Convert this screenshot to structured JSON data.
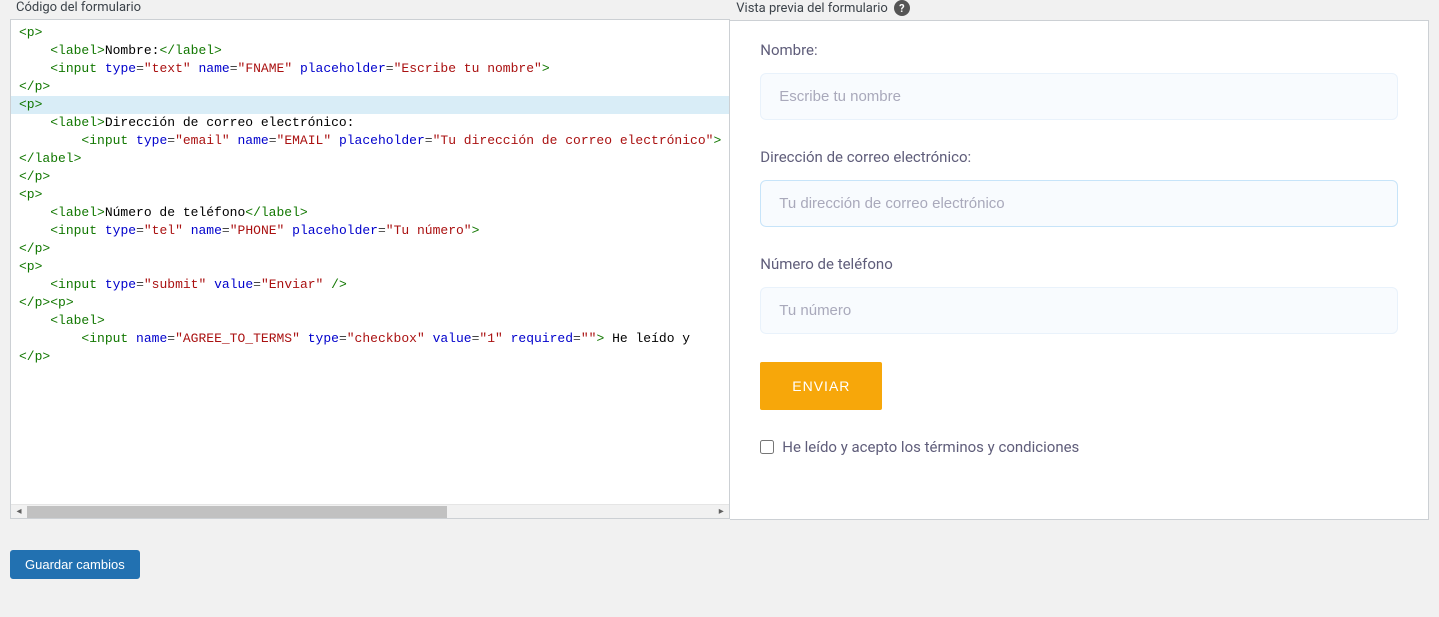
{
  "headers": {
    "code_panel": "Código del formulario",
    "preview_panel": "Vista previa del formulario"
  },
  "code": {
    "lines": [
      {
        "t": "open",
        "tag": "p",
        "indent": 0,
        "hl": false
      },
      {
        "t": "label",
        "tag": "label",
        "text": "Nombre:",
        "indent": 1,
        "hl": false
      },
      {
        "t": "input",
        "tag": "input",
        "attrs": [
          [
            "type",
            "text"
          ],
          [
            "name",
            "FNAME"
          ],
          [
            "placeholder",
            "Escribe tu nombre"
          ]
        ],
        "indent": 1,
        "hl": false
      },
      {
        "t": "close",
        "tag": "p",
        "indent": 0,
        "hl": false
      },
      {
        "t": "open",
        "tag": "p",
        "indent": 0,
        "hl": true
      },
      {
        "t": "labelopen",
        "tag": "label",
        "text": "Dirección de correo electrónico:",
        "indent": 1,
        "hl": false
      },
      {
        "t": "input",
        "tag": "input",
        "attrs": [
          [
            "type",
            "email"
          ],
          [
            "name",
            "EMAIL"
          ],
          [
            "placeholder",
            "Tu dirección de correo electrónico"
          ]
        ],
        "indent": 2,
        "hl": false
      },
      {
        "t": "close",
        "tag": "label",
        "indent": 0,
        "hl": false
      },
      {
        "t": "close",
        "tag": "p",
        "indent": 0,
        "hl": false
      },
      {
        "t": "open",
        "tag": "p",
        "indent": 0,
        "hl": false
      },
      {
        "t": "label",
        "tag": "label",
        "text": "Número de teléfono",
        "indent": 1,
        "hl": false
      },
      {
        "t": "input",
        "tag": "input",
        "attrs": [
          [
            "type",
            "tel"
          ],
          [
            "name",
            "PHONE"
          ],
          [
            "placeholder",
            "Tu número"
          ]
        ],
        "indent": 1,
        "hl": false
      },
      {
        "t": "close",
        "tag": "p",
        "indent": 0,
        "hl": false
      },
      {
        "t": "open",
        "tag": "p",
        "indent": 0,
        "hl": false
      },
      {
        "t": "input_self",
        "tag": "input",
        "attrs": [
          [
            "type",
            "submit"
          ],
          [
            "value",
            "Enviar"
          ]
        ],
        "indent": 1,
        "hl": false
      },
      {
        "t": "close_open",
        "closetag": "p",
        "opentag": "p",
        "indent": 0,
        "hl": false
      },
      {
        "t": "open",
        "tag": "label",
        "indent": 1,
        "hl": false
      },
      {
        "t": "input_text",
        "tag": "input",
        "attrs": [
          [
            "name",
            "AGREE_TO_TERMS"
          ],
          [
            "type",
            "checkbox"
          ],
          [
            "value",
            "1"
          ],
          [
            "required",
            ""
          ]
        ],
        "trailing": " He leído y ",
        "indent": 2,
        "hl": false
      },
      {
        "t": "close",
        "tag": "p",
        "indent": 0,
        "hl": false
      }
    ]
  },
  "preview": {
    "fields": [
      {
        "label": "Nombre:",
        "placeholder": "Escribe tu nombre",
        "type": "text",
        "highlight": false
      },
      {
        "label": "Dirección de correo electrónico:",
        "placeholder": "Tu dirección de correo electrónico",
        "type": "email",
        "highlight": true
      },
      {
        "label": "Número de teléfono",
        "placeholder": "Tu número",
        "type": "tel",
        "highlight": false
      }
    ],
    "submit_label": "ENVIAR",
    "terms_label": "He leído y acepto los términos y condiciones"
  },
  "buttons": {
    "save": "Guardar cambios"
  }
}
